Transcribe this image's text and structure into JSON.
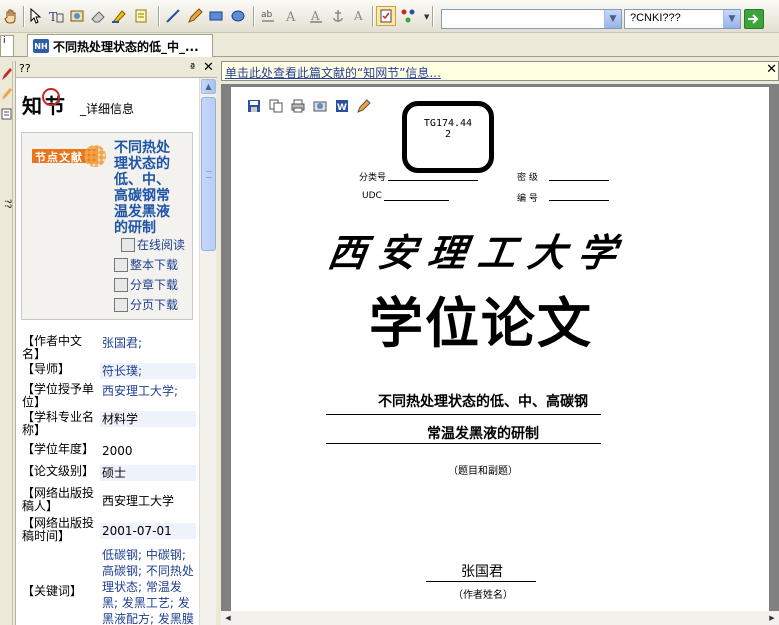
{
  "toolbar": {
    "search_combo_value": "",
    "source_combo_value": "?CNKI???"
  },
  "tab": {
    "mini_label": "i",
    "title": "不同热处理状态的低_中_..."
  },
  "left_strip": {
    "label": "??"
  },
  "panel": {
    "header_title": "??",
    "pin_symbol": "ª",
    "close_symbol": "✕",
    "logo_text": "知  节",
    "detail_link": "_详细信息",
    "badge_text": "节点文献",
    "card_title": "不同热处理状态的低、中、高碳钢常温发黑液的研制",
    "actions": {
      "read_online": "在线阅读",
      "download_full": "整本下载",
      "download_chapter": "分章下载",
      "download_page": "分页下载"
    },
    "info": [
      {
        "key": "【作者中文名】",
        "value": "张国君;"
      },
      {
        "key": "【导师】",
        "value": "符长璞;"
      },
      {
        "key": "【学位授予单位】",
        "value": "西安理工大学;"
      },
      {
        "key": "【学科专业名称】",
        "value": "材料学"
      },
      {
        "key": "【学位年度】",
        "value": "2000"
      },
      {
        "key": "【论文级别】",
        "value": "硕士"
      },
      {
        "key": "【网络出版投稿人】",
        "value": "西安理工大学"
      },
      {
        "key": "【网络出版投稿时间】",
        "value": "2001-07-01"
      },
      {
        "key": "【关键词】",
        "value": "低碳钢; 中碳钢; 高碳钢; 不同热处理状态; 常温发黑; 发黑工艺; 发黑液配方; 发黑膜膜层性能;"
      }
    ]
  },
  "notice": {
    "text": "单击此处查看此篇文献的“知网节”信息...",
    "close_symbol": "✕"
  },
  "document": {
    "stamp_line1": "TG174.44",
    "stamp_line2": "2",
    "label_class_no": "分类号",
    "label_secret": "密  级",
    "label_udc": "UDC",
    "label_number": "编  号",
    "university": "西安理工大学",
    "doc_type": "学位论文",
    "title_line1": "不同热处理状态的低、中、高碳钢",
    "title_line2": "常温发黑液的研制",
    "title_note": "（题目和副题）",
    "author": "张国君",
    "author_note": "（作者姓名）"
  },
  "colors": {
    "link_blue": "#1f3f8f",
    "title_blue": "#1f55a6",
    "badge_orange": "#e9761c",
    "notice_bg": "#ffffe1",
    "go_green": "#3ca53a"
  }
}
